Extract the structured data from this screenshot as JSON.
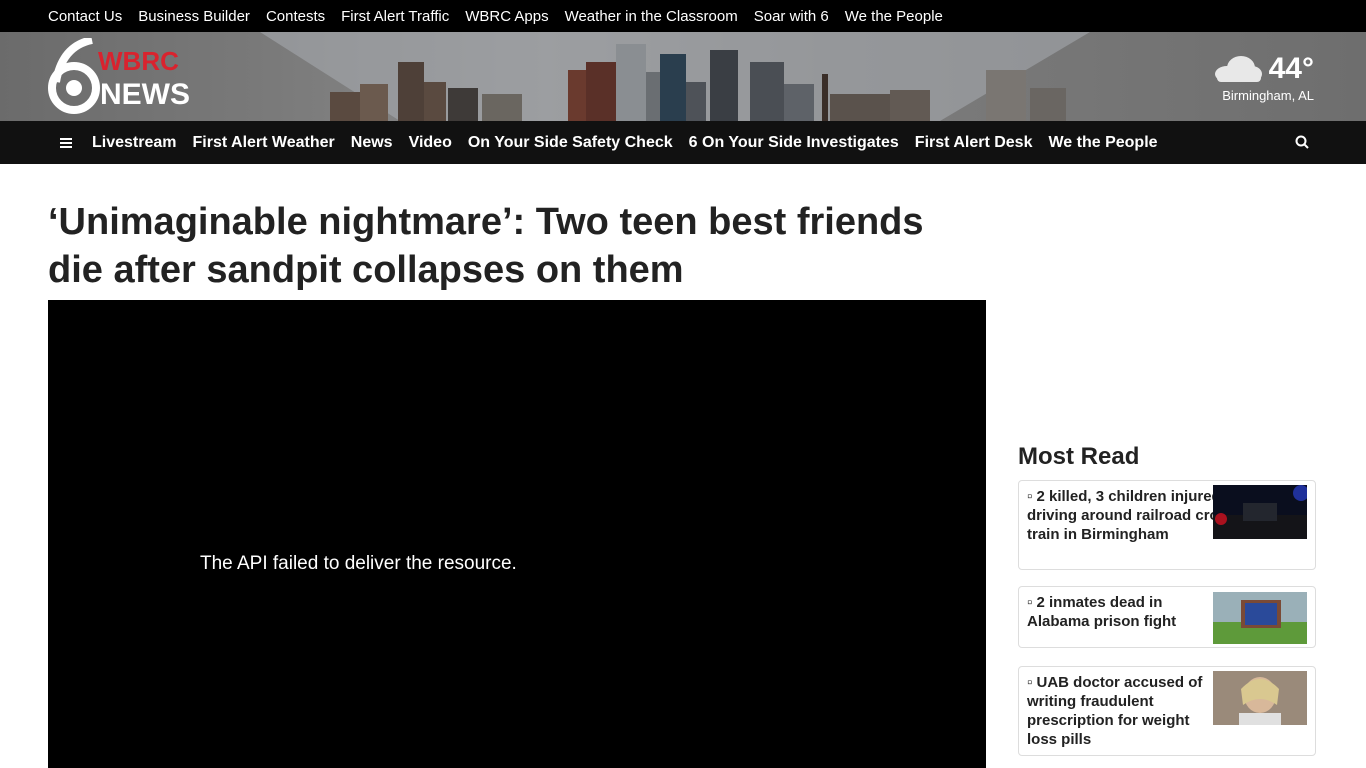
{
  "top_links": [
    "Contact Us",
    "Business Builder",
    "Contests",
    "First Alert Traffic",
    "WBRC Apps",
    "Weather in the Classroom",
    "Soar with 6",
    "We the People"
  ],
  "logo": {
    "top": "WBRC",
    "bottom": "NEWS",
    "numeral": "6"
  },
  "weather": {
    "temp": "44°",
    "city": "Birmingham, AL",
    "icon": "cloud-icon"
  },
  "nav": [
    "Livestream",
    "First Alert Weather",
    "News",
    "Video",
    "On Your Side Safety Check",
    "6 On Your Side Investigates",
    "First Alert Desk",
    "We the People"
  ],
  "article": {
    "title": "‘Unimaginable nightmare’: Two teen best friends die after sandpit collapses on them",
    "video_error": "The API failed to deliver the resource."
  },
  "most_read": {
    "title": "Most Read",
    "items": [
      {
        "text": "2 killed, 3 children injured while driving around railroad crossing, hit by train in Birmingham"
      },
      {
        "text": "2 inmates dead in Alabama prison fight"
      },
      {
        "text": "UAB doctor accused of writing fraudulent prescription for weight loss pills"
      }
    ]
  },
  "colors": {
    "brand_red": "#d9232e",
    "nav_bg": "#111111",
    "top_bg": "#000000"
  }
}
